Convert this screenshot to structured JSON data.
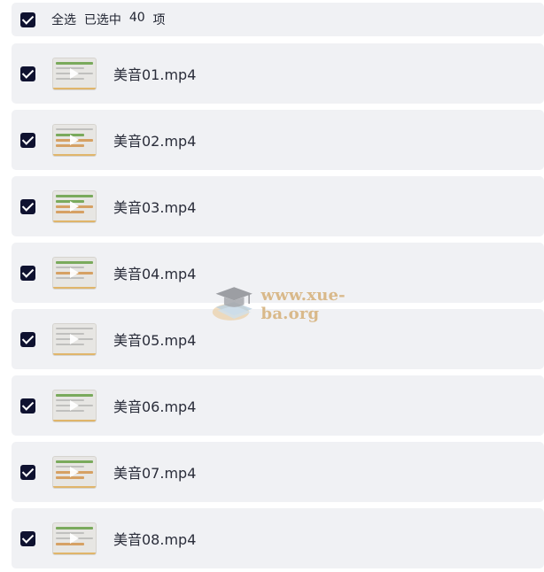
{
  "select_bar": {
    "select_all_label": "全选",
    "selected_prefix": "已选中",
    "selected_count": "40",
    "selected_suffix": "项"
  },
  "files": [
    {
      "name": "美音01.mp4",
      "checked": true
    },
    {
      "name": "美音02.mp4",
      "checked": true
    },
    {
      "name": "美音03.mp4",
      "checked": true
    },
    {
      "name": "美音04.mp4",
      "checked": true
    },
    {
      "name": "美音05.mp4",
      "checked": true
    },
    {
      "name": "美音06.mp4",
      "checked": true
    },
    {
      "name": "美音07.mp4",
      "checked": true
    },
    {
      "name": "美音08.mp4",
      "checked": true
    }
  ],
  "watermark": {
    "text": "www.xue-ba.org",
    "icon": "graduation-cap-books-icon"
  },
  "colors": {
    "row_background": "#f0f1f4",
    "checkbox": "#0f1230",
    "watermark": "#d9b98a"
  }
}
